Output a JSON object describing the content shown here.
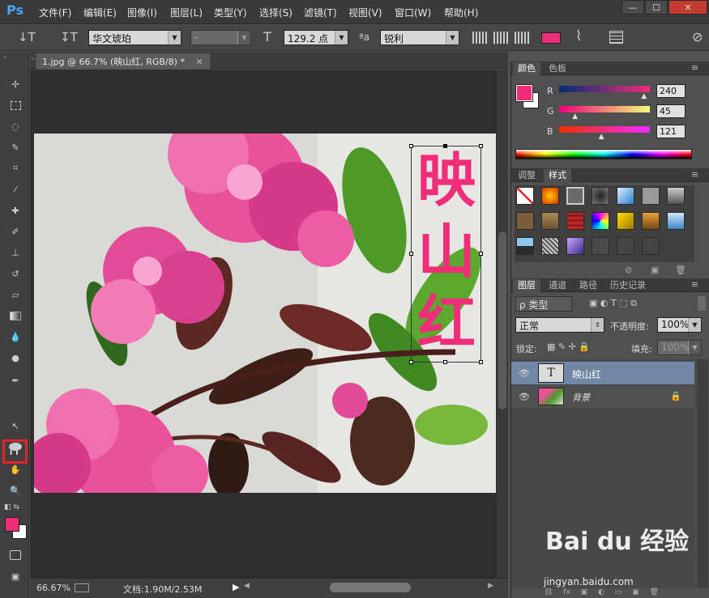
{
  "app": {
    "logo": "Ps"
  },
  "menu": [
    "文件(F)",
    "编辑(E)",
    "图像(I)",
    "图层(L)",
    "类型(Y)",
    "选择(S)",
    "滤镜(T)",
    "视图(V)",
    "窗口(W)",
    "帮助(H)"
  ],
  "window_controls": [
    "—",
    "☐",
    "✕"
  ],
  "options": {
    "tool_icon": "↓T",
    "orient_icon": "↧T",
    "font_family": "华文琥珀",
    "font_style": "-",
    "size_icon": "T",
    "font_size": "129.2 点",
    "aa_icon": "ªa",
    "antialias": "锐利",
    "text_color": "#f02d79"
  },
  "document": {
    "tab_title": "1.jpg @ 66.7% (映山红, RGB/8) *",
    "overlay_text": [
      "映",
      "山",
      "红"
    ],
    "text_color": "#f02d79"
  },
  "status": {
    "zoom": "66.67%",
    "doc_info": "文档:1.90M/2.53M"
  },
  "colors": {
    "foreground": "#f02d79",
    "background": "#ffffff"
  },
  "color_panel": {
    "tabs": [
      "颜色",
      "色板"
    ],
    "channels": [
      {
        "label": "R",
        "value": "240",
        "fraction": 0.94
      },
      {
        "label": "G",
        "value": "45",
        "fraction": 0.18
      },
      {
        "label": "B",
        "value": "121",
        "fraction": 0.47
      }
    ]
  },
  "styles_panel": {
    "tabs": [
      "调整",
      "样式"
    ]
  },
  "layers_panel": {
    "tabs": [
      "图层",
      "通道",
      "路径",
      "历史记录"
    ],
    "filter_label": "ρ 类型",
    "blend_mode": "正常",
    "opacity_label": "不透明度:",
    "opacity_value": "100%",
    "lock_label": "锁定:",
    "fill_label": "填充:",
    "fill_value": "100%",
    "layers": [
      {
        "name": "映山红",
        "thumb": "T"
      },
      {
        "name": "背景"
      }
    ]
  },
  "watermark": {
    "brand": "Bai du 经验",
    "url": "jingyan.baidu.com"
  }
}
